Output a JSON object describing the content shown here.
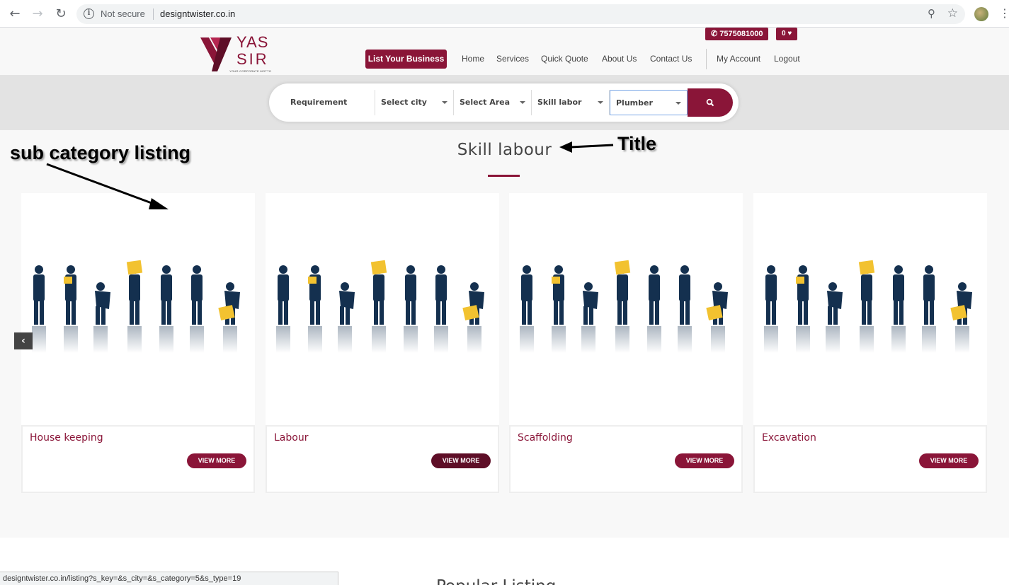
{
  "browser": {
    "security_label": "Not secure",
    "url": "designtwister.co.in",
    "status_url": "designtwister.co.in/listing?s_key=&s_city=&s_category=5&s_type=19"
  },
  "header": {
    "logo_line1": "YAS",
    "logo_line2": "SIR",
    "logo_tagline": "YOUR CORPORATE MOTTO",
    "phone": "7575081000",
    "wishlist_count": "0",
    "list_business": "List Your Business",
    "nav": [
      "Home",
      "Services",
      "Quick Quote",
      "About Us",
      "Contact Us"
    ],
    "account": [
      "My Account",
      "Logout"
    ]
  },
  "search": {
    "requirement": "Requirement",
    "city": "Select city",
    "area": "Select Area",
    "category": "Skill labor",
    "subcategory": "Plumber"
  },
  "section": {
    "title": "Skill labour",
    "cards": [
      {
        "name": "House keeping",
        "button": "VIEW MORE"
      },
      {
        "name": "Labour",
        "button": "VIEW MORE"
      },
      {
        "name": "Scaffolding",
        "button": "VIEW MORE"
      },
      {
        "name": "Excavation",
        "button": "VIEW MORE"
      }
    ]
  },
  "annotations": {
    "sub_category": "sub category listing",
    "title": "Title"
  },
  "lower": {
    "title_partial": "Popular Listing"
  },
  "colors": {
    "brand": "#8a1538",
    "figure": "#14304f",
    "box": "#f2c230"
  }
}
